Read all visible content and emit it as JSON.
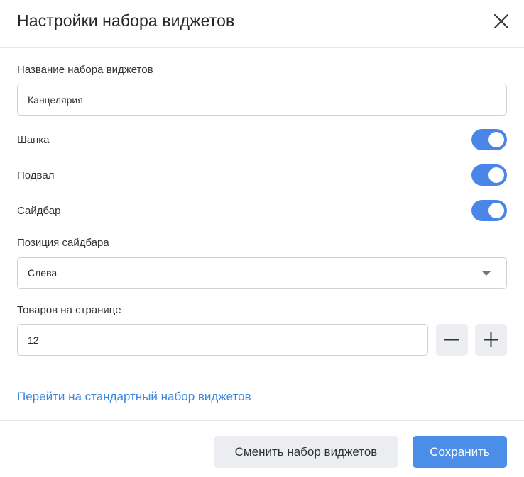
{
  "dialog": {
    "title": "Настройки набора виджетов",
    "close_icon": "close-icon"
  },
  "name_field": {
    "label": "Название набора виджетов",
    "value": "Канцелярия"
  },
  "toggles": [
    {
      "label": "Шапка",
      "on": true
    },
    {
      "label": "Подвал",
      "on": true
    },
    {
      "label": "Сайдбар",
      "on": true
    }
  ],
  "sidebar_position": {
    "label": "Позиция сайдбара",
    "value": "Слева",
    "caret_icon": "caret-down-icon"
  },
  "items_per_page": {
    "label": "Товаров на странице",
    "value": "12",
    "minus_icon": "minus-icon",
    "plus_icon": "plus-icon"
  },
  "link": {
    "label": "Перейти на стандартный набор виджетов"
  },
  "footer": {
    "secondary_label": "Сменить набор виджетов",
    "primary_label": "Сохранить"
  },
  "colors": {
    "accent": "#4a86e8",
    "link": "#3d87e0",
    "border": "#cfd1d6",
    "secondary_button_bg": "#ebedf0"
  }
}
